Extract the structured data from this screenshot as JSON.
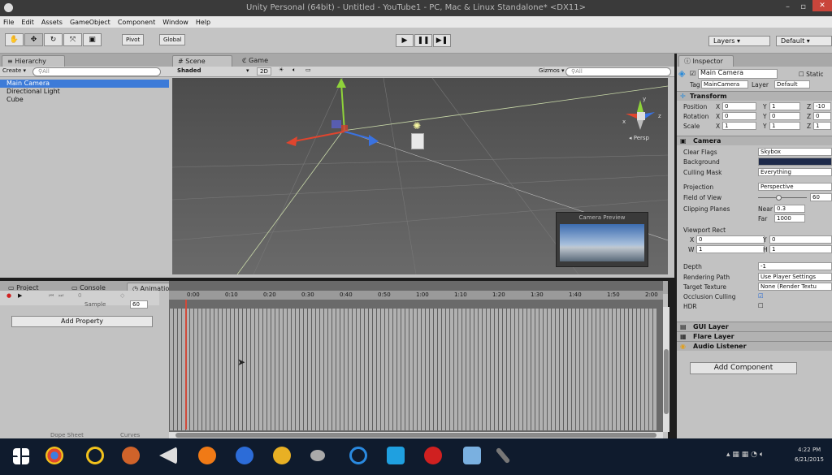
{
  "window": {
    "title": "Unity Personal (64bit) - Untitled - YouTube1 - PC, Mac & Linux Standalone* <DX11>",
    "minimize": "–",
    "maximize": "▫",
    "close": "✕"
  },
  "menu": [
    "File",
    "Edit",
    "Assets",
    "GameObject",
    "Component",
    "Window",
    "Help"
  ],
  "toolbar": {
    "pivot": "Pivot",
    "global": "Global",
    "play": "▶",
    "pause": "❚❚",
    "step": "▶❚",
    "layers": "Layers",
    "layout": "Default"
  },
  "hierarchy": {
    "tab": "Hierarchy",
    "create": "Create",
    "search": "All",
    "items": [
      "Main Camera",
      "Directional Light",
      "Cube"
    ]
  },
  "scene": {
    "tab_scene": "Scene",
    "tab_game": "Game",
    "shading": "Shaded",
    "mode2d": "2D",
    "gizmos": "Gizmos",
    "search": "All",
    "persp": "Persp",
    "preview_title": "Camera Preview",
    "axis_x": "x",
    "axis_y": "y",
    "axis_z": "z"
  },
  "bottom_tabs": {
    "project": "Project",
    "console": "Console",
    "animation": "Animation"
  },
  "animation": {
    "sample_label": "Sample",
    "sample_value": "60",
    "frame": "0",
    "add_property": "Add Property",
    "dope_sheet": "Dope Sheet",
    "curves": "Curves",
    "ticks": [
      "0:00",
      "0:10",
      "0:20",
      "0:30",
      "0:40",
      "0:50",
      "1:00",
      "1:10",
      "1:20",
      "1:30",
      "1:40",
      "1:50",
      "2:00"
    ]
  },
  "inspector": {
    "tab": "Inspector",
    "object_name": "Main Camera",
    "static": "Static",
    "tag_label": "Tag",
    "tag_value": "MainCamera",
    "layer_label": "Layer",
    "layer_value": "Default",
    "transform": {
      "title": "Transform",
      "position": "Position",
      "rotation": "Rotation",
      "scale": "Scale",
      "pos": [
        "0",
        "1",
        "-10"
      ],
      "rot": [
        "0",
        "0",
        "0"
      ],
      "scl": [
        "1",
        "1",
        "1"
      ]
    },
    "camera": {
      "title": "Camera",
      "clear_flags": "Clear Flags",
      "clear_flags_val": "Skybox",
      "background": "Background",
      "culling_mask": "Culling Mask",
      "culling_mask_val": "Everything",
      "projection": "Projection",
      "projection_val": "Perspective",
      "fov": "Field of View",
      "fov_val": "60",
      "clipping": "Clipping Planes",
      "near": "Near",
      "near_val": "0.3",
      "far": "Far",
      "far_val": "1000",
      "viewport": "Viewport Rect",
      "vx": "0",
      "vy": "0",
      "vw": "1",
      "vh": "1",
      "depth": "Depth",
      "depth_val": "-1",
      "rendering_path": "Rendering Path",
      "rendering_path_val": "Use Player Settings",
      "target_texture": "Target Texture",
      "target_texture_val": "None (Render Textu",
      "occlusion": "Occlusion Culling",
      "hdr": "HDR"
    },
    "components": [
      "GUI Layer",
      "Flare Layer",
      "Audio Listener"
    ],
    "add_component": "Add Component"
  },
  "taskbar": {
    "time": "4:22 PM",
    "date": "6/21/2015"
  }
}
